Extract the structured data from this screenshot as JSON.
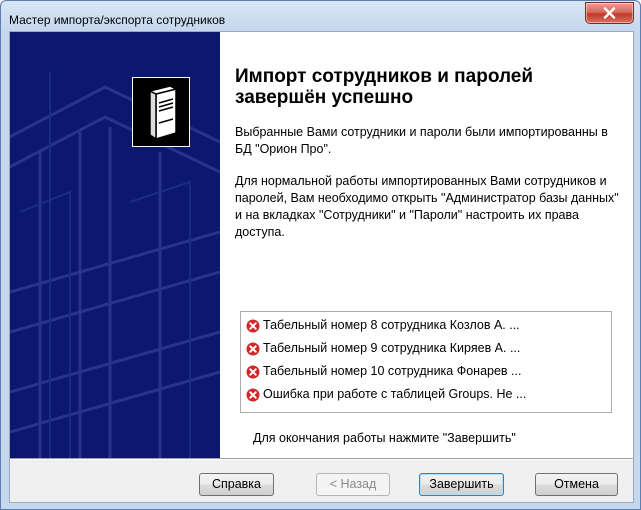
{
  "window": {
    "title": "Мастер импорта/экспорта сотрудников"
  },
  "page": {
    "heading": "Импорт сотрудников и паролей завершён успешно",
    "paragraph1": "Выбранные Вами сотрудники и пароли были импортированны в БД \"Орион Про\".",
    "paragraph2": "Для нормальной работы импортированных Вами сотрудников и паролей, Вам необходимо открыть \"Администратор базы данных\" и на вкладках \"Сотрудники\" и \"Пароли\" настроить их права доступа.",
    "log_items": [
      {
        "icon": "error-icon",
        "text": "Табельный номер 8 сотрудника Козлов А. ..."
      },
      {
        "icon": "error-icon",
        "text": "Табельный номер 9 сотрудника Киряев А. ..."
      },
      {
        "icon": "error-icon",
        "text": "Табельный номер 10 сотрудника Фонарев ..."
      },
      {
        "icon": "error-icon",
        "text": "Ошибка при работе с таблицей Groups. Не ..."
      }
    ],
    "finish_hint": "Для окончания работы нажмите \"Завершить\""
  },
  "buttons": {
    "help": "Справка",
    "back": "< Назад",
    "finish": "Завершить",
    "cancel": "Отмена"
  },
  "colors": {
    "side_panel": "#0c1870",
    "error": "#d3262b",
    "title_close": "#c0392b"
  }
}
